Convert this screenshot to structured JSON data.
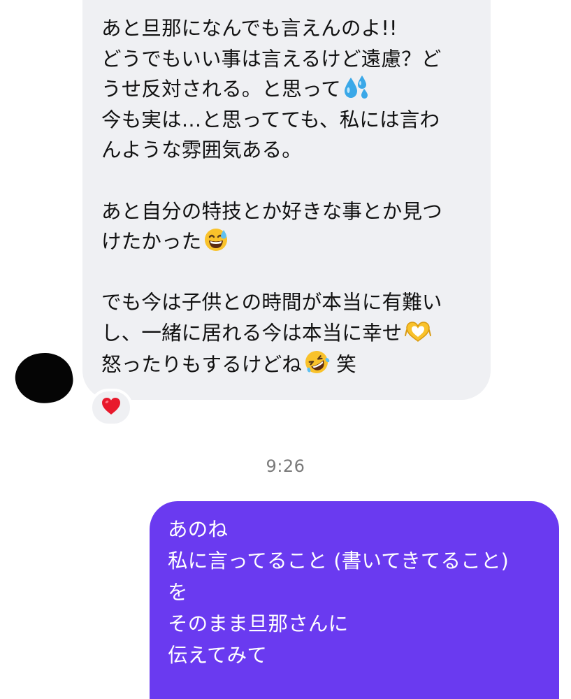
{
  "incoming_message": {
    "lines": [
      "あと旦那になんでも言えんのよ!!",
      "どうでもいい事は言えるけど遠慮？ど",
      "うせ反対される。と思って",
      "今も実は…と思ってても、私には言わ",
      "んような雰囲気ある。",
      "",
      "あと自分の特技とか好きな事とか見つ",
      "けたかった",
      "",
      "でも今は子供との時間が本当に有難い",
      "し、一緒に居れる今は本当に幸せ",
      "怒ったりもするけどね",
      "笑"
    ],
    "emojis": [
      "sweat-droplets",
      "grinning-sweat-face",
      "heart-hands",
      "rolling-on-floor-laughing-face"
    ]
  },
  "reaction": {
    "emoji": "red-heart",
    "color": "#e8192c"
  },
  "timestamp": "9:26",
  "outgoing_message": {
    "lines": [
      "あのね",
      "私に言ってること (書いてきてること)",
      "を",
      "そのまま旦那さんに",
      "伝えてみて"
    ]
  },
  "colors": {
    "incoming_bubble": "#eff0f3",
    "outgoing_bubble": "#6a3af0",
    "timestamp_text": "#7a7a7a"
  }
}
